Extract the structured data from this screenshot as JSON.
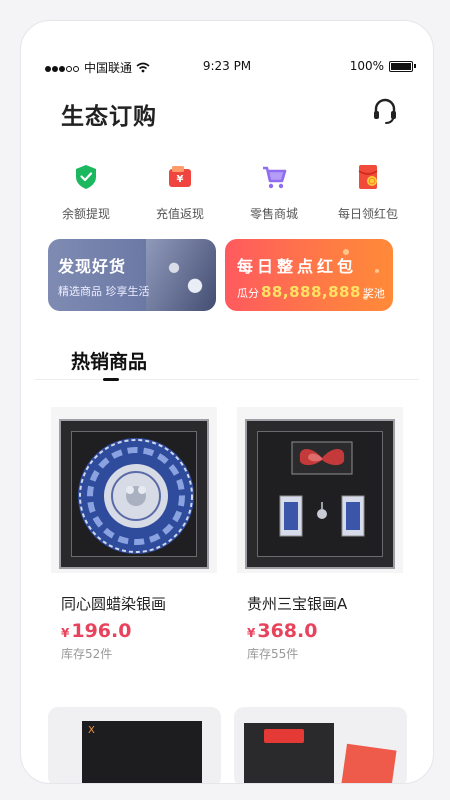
{
  "status_bar": {
    "carrier": "中国联通",
    "time": "9:23 PM",
    "battery": "100%"
  },
  "header": {
    "title": "生态订购",
    "support_icon": "headset-icon"
  },
  "quick_actions": [
    {
      "label": "余额提现",
      "icon": "shield-icon",
      "color": "#1bb85f"
    },
    {
      "label": "充值返现",
      "icon": "wallet-icon",
      "color": "#f0453f"
    },
    {
      "label": "零售商城",
      "icon": "cart-icon",
      "color": "#8f6cf0"
    },
    {
      "label": "每日领红包",
      "icon": "red-envelope-icon",
      "color": "#f24b3a"
    }
  ],
  "banners": {
    "discover": {
      "title": "发现好货",
      "subtitle": "精选商品 珍享生活"
    },
    "daily": {
      "title": "每日整点红包",
      "prefix": "瓜分",
      "amount": "88,888,888",
      "suffix": "奖池"
    }
  },
  "section": {
    "title": "热销商品"
  },
  "products": [
    {
      "name": "同心圆蜡染银画",
      "currency": "¥",
      "price": "196.0",
      "stock": "库存52件"
    },
    {
      "name": "贵州三宝银画A",
      "currency": "¥",
      "price": "368.0",
      "stock": "库存55件"
    }
  ],
  "colors": {
    "accent_price": "#e8435d",
    "banner_blue": "#6c7aa6",
    "banner_red": "#ff5a5f"
  }
}
